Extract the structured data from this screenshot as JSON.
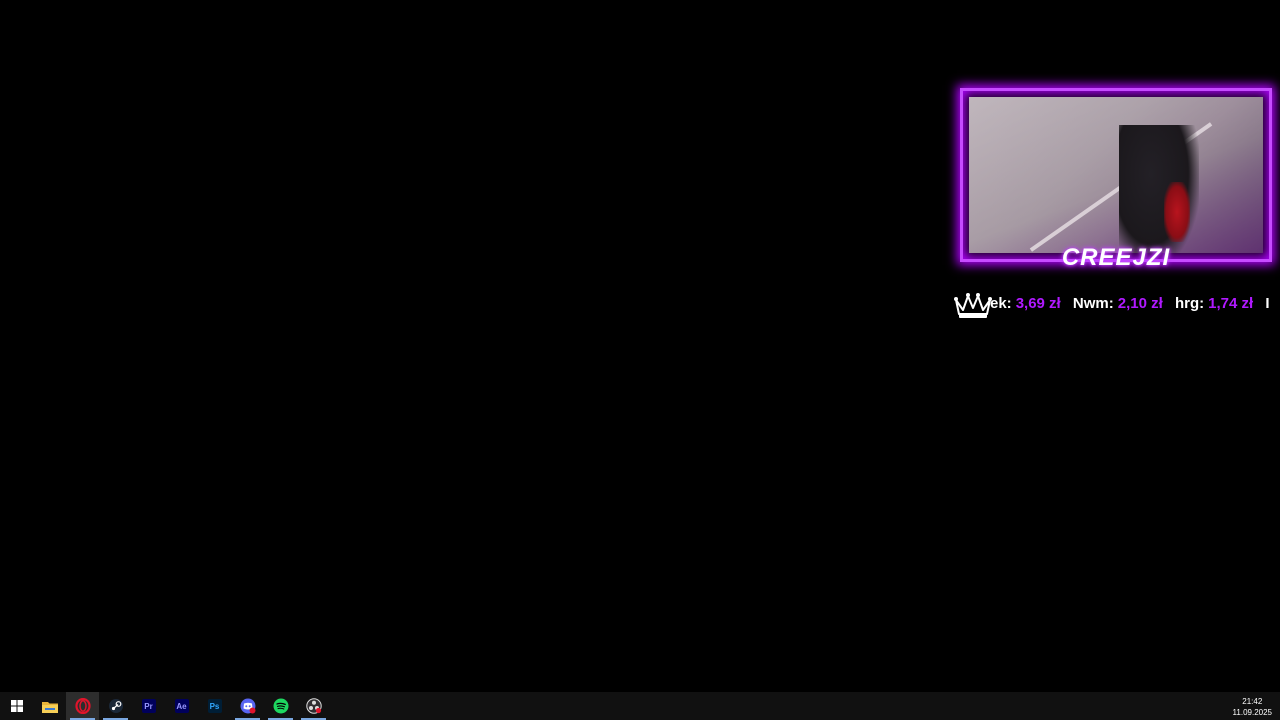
{
  "overlay": {
    "streamer_name": "CREEJZI",
    "ticker": [
      {
        "name": "ek:",
        "amount": "3,69 zł"
      },
      {
        "name": "Nwm:",
        "amount": "2,10 zł"
      },
      {
        "name": "hrg:",
        "amount": "1,74 zł"
      },
      {
        "name": "I",
        "amount": ""
      }
    ],
    "accent_color": "#b019ff"
  },
  "taskbar": {
    "items": [
      {
        "icon": "windows-start-icon",
        "state": "normal"
      },
      {
        "icon": "file-explorer-icon",
        "state": "normal"
      },
      {
        "icon": "opera-icon",
        "state": "active"
      },
      {
        "icon": "steam-icon",
        "state": "open"
      },
      {
        "icon": "premiere-pro-icon",
        "label": "Pr",
        "state": "normal"
      },
      {
        "icon": "after-effects-icon",
        "label": "Ae",
        "state": "normal"
      },
      {
        "icon": "photoshop-icon",
        "label": "Ps",
        "state": "normal"
      },
      {
        "icon": "discord-icon",
        "state": "open"
      },
      {
        "icon": "spotify-icon",
        "state": "open"
      },
      {
        "icon": "obs-icon",
        "state": "open"
      }
    ],
    "clock": {
      "time": "21:42",
      "date": "11.09.2025"
    }
  }
}
